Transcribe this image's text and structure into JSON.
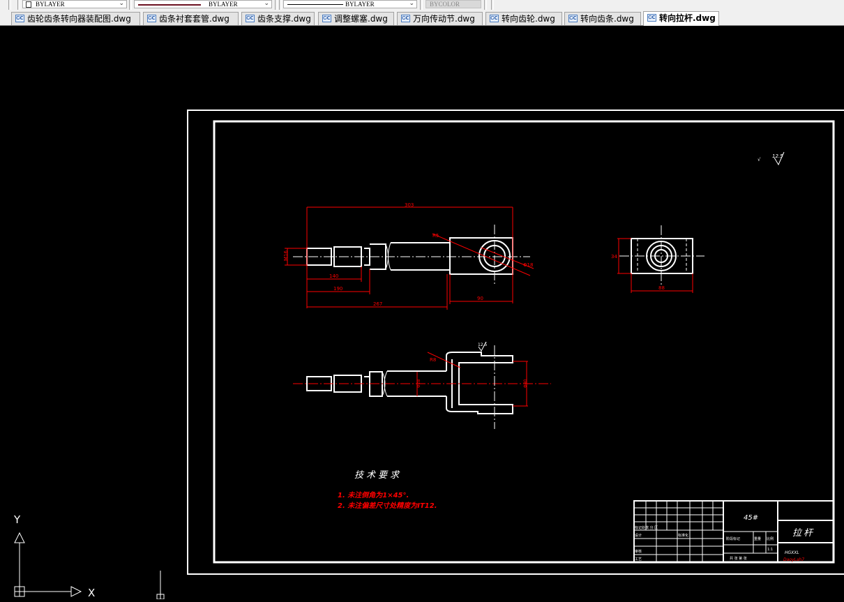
{
  "toolbar": {
    "layer_combo": "BYLAYER",
    "linetype_combo": "BYLAYER",
    "lineweight_combo": "BYLAYER",
    "plotstyle_combo": "BYCOLOR"
  },
  "tabs": [
    {
      "label": "齿轮齿条转向器装配图.dwg",
      "active": false
    },
    {
      "label": "齿条衬套套管.dwg",
      "active": false
    },
    {
      "label": "齿条支撑.dwg",
      "active": false
    },
    {
      "label": "调整螺塞.dwg",
      "active": false
    },
    {
      "label": "万向传动节.dwg",
      "active": false
    },
    {
      "label": "转向齿轮.dwg",
      "active": false
    },
    {
      "label": "转向齿条.dwg",
      "active": false
    },
    {
      "label": "转向拉杆.dwg",
      "active": true
    }
  ],
  "tab_icon_text": "ᏟC",
  "drawing": {
    "roughness_value": "12.5",
    "dims": {
      "overall_length": "303",
      "thread_dia": "M16",
      "len_140": "140",
      "len_190": "190",
      "len_267": "267",
      "eye_len": "90",
      "eye_chamfer": "R5",
      "eye_bore": "Φ18",
      "side_height": "34",
      "side_width": "88",
      "bottom_roughness": "12.5",
      "fork_r": "R8",
      "fork_dia": "Φ28",
      "fork_open": "Φ40"
    },
    "notes_title": "技术要求",
    "notes": [
      "1. 未注倒角为1×45°.",
      "2. 未注偏差尺寸处精度为IT12."
    ],
    "title_block": {
      "material": "45#",
      "part_name": "拉杆",
      "school": "HGXXL",
      "drawing_no": "DaoyLah7",
      "row_labels": [
        "标记处数 分 区",
        "设计",
        "审核",
        "工艺"
      ],
      "stage_label": "阶段标记",
      "weight_label": "重量",
      "scale_label": "比例",
      "scale_value": "1:1",
      "sheet_label": "共 张 第 张",
      "standard_label": "标准化"
    }
  },
  "ucs": {
    "y_label": "Y",
    "x_label": "X"
  },
  "colors": {
    "canvas_bg": "#000000",
    "geometry": "#ffffff",
    "dimension": "#ff0000",
    "frame": "#ffffff"
  }
}
